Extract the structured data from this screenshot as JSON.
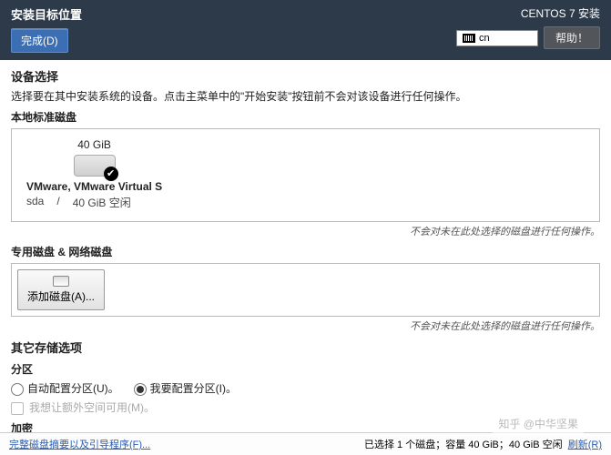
{
  "top": {
    "title": "安装目标位置",
    "done": "完成(D)",
    "install": "CENTOS 7 安装",
    "kb": "cn",
    "help": "帮助！"
  },
  "dev": {
    "title": "设备选择",
    "desc": "选择要在其中安装系统的设备。点击主菜单中的\"开始安装\"按钮前不会对该设备进行任何操作。",
    "local": "本地标准磁盘",
    "disk_size": "40 GiB",
    "disk_name": "VMware, VMware Virtual S",
    "disk_id": "sda",
    "disk_sep": "/",
    "disk_free": "40 GiB 空闲",
    "hint1": "不会对未在此处选择的磁盘进行任何操作。",
    "special": "专用磁盘 & 网络磁盘",
    "add_disk": "添加磁盘(A)...",
    "hint2": "不会对未在此处选择的磁盘进行任何操作。"
  },
  "other": {
    "title": "其它存储选项",
    "part": "分区",
    "auto": "自动配置分区(U)。",
    "manual": "我要配置分区(I)。",
    "extra": "我想让额外空间可用(M)。",
    "encrypt": "加密"
  },
  "bottom": {
    "link": "完整磁盘摘要以及引导程序(F)...",
    "status": "已选择 1 个磁盘；容量 40 GiB；40 GiB 空闲",
    "refresh": "刷新(R)"
  },
  "watermark": "知乎 @中华坚果"
}
